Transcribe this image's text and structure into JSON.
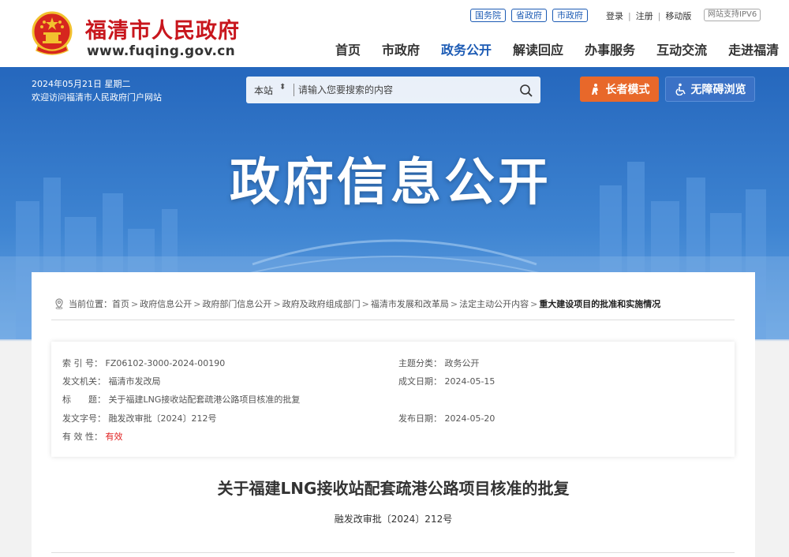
{
  "header": {
    "site_name": "福清市人民政府",
    "site_domain": "www.fuqing.gov.cn",
    "gov_links": [
      "国务院",
      "省政府",
      "市政府"
    ],
    "util_links": [
      "登录",
      "注册",
      "移动版"
    ],
    "ipv6": "网站支持IPV6",
    "nav": [
      "首页",
      "市政府",
      "政务公开",
      "解读回应",
      "办事服务",
      "互动交流",
      "走进福清"
    ],
    "active_nav": "政务公开"
  },
  "banner": {
    "date": "2024年05月21日 星期二",
    "welcome": "欢迎访问福清市人民政府门户网站",
    "search_scope": "本站",
    "search_placeholder": "请输入您要搜索的内容",
    "elder_mode": "长者模式",
    "accessibility": "无障碍浏览",
    "title": "政府信息公开"
  },
  "breadcrumb": {
    "prefix": "当前位置：",
    "items": [
      "首页",
      "政府信息公开",
      "政府部门信息公开",
      "政府及政府组成部门",
      "福清市发展和改革局",
      "法定主动公开内容",
      "重大建设项目的批准和实施情况"
    ]
  },
  "info": {
    "index_label": "索 引 号：",
    "index_value": "FZ06102-3000-2024-00190",
    "topic_label": "主题分类：",
    "topic_value": "政务公开",
    "issuer_label": "发文机关：",
    "issuer_value": "福清市发改局",
    "created_label": "成文日期：",
    "created_value": "2024-05-15",
    "title_label": "标　　题：",
    "title_value": "关于福建LNG接收站配套疏港公路项目核准的批复",
    "docno_label": "发文字号：",
    "docno_value": "融发改审批〔2024〕212号",
    "published_label": "发布日期：",
    "published_value": "2024-05-20",
    "validity_label": "有 效 性：",
    "validity_value": "有效"
  },
  "document": {
    "title": "关于福建LNG接收站配套疏港公路项目核准的批复",
    "number": "融发改审批〔2024〕212号"
  },
  "colors": {
    "brand_red": "#c8161d",
    "brand_blue": "#1c5bb4",
    "elder_orange": "#e8682a",
    "valid_red": "#e02020"
  }
}
